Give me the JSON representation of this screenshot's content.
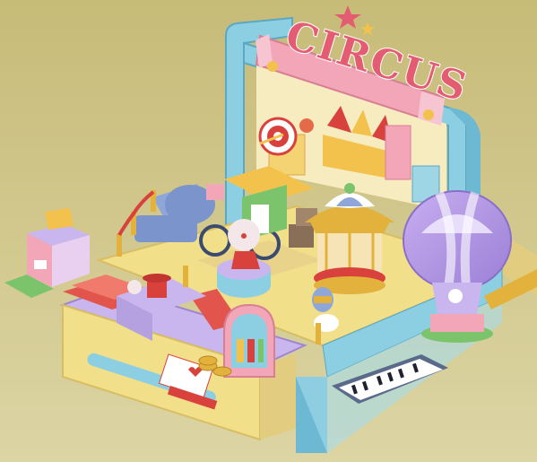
{
  "scene": {
    "sign_text": "CIRCUS",
    "palette": {
      "background_top": "#c9bd7e",
      "background_bottom": "#d6cf9c",
      "frame_blue": "#8ccfe3",
      "frame_blue_dark": "#5aa8c4",
      "floor_yellow": "#f2df8a",
      "sign_pink": "#f2a6b8",
      "sign_text": "#e45c72",
      "balloon_purple": "#b89ae6",
      "balloon_white": "#f4efff",
      "drawer_lavender": "#c9b6ee",
      "carousel_gold": "#e3b23c",
      "red_accent": "#d9413c",
      "green_accent": "#7bc46c"
    },
    "icons": {
      "star": "star-icon",
      "paw": "paw-icon",
      "target": "target-icon",
      "heart": "heart-icon"
    }
  }
}
